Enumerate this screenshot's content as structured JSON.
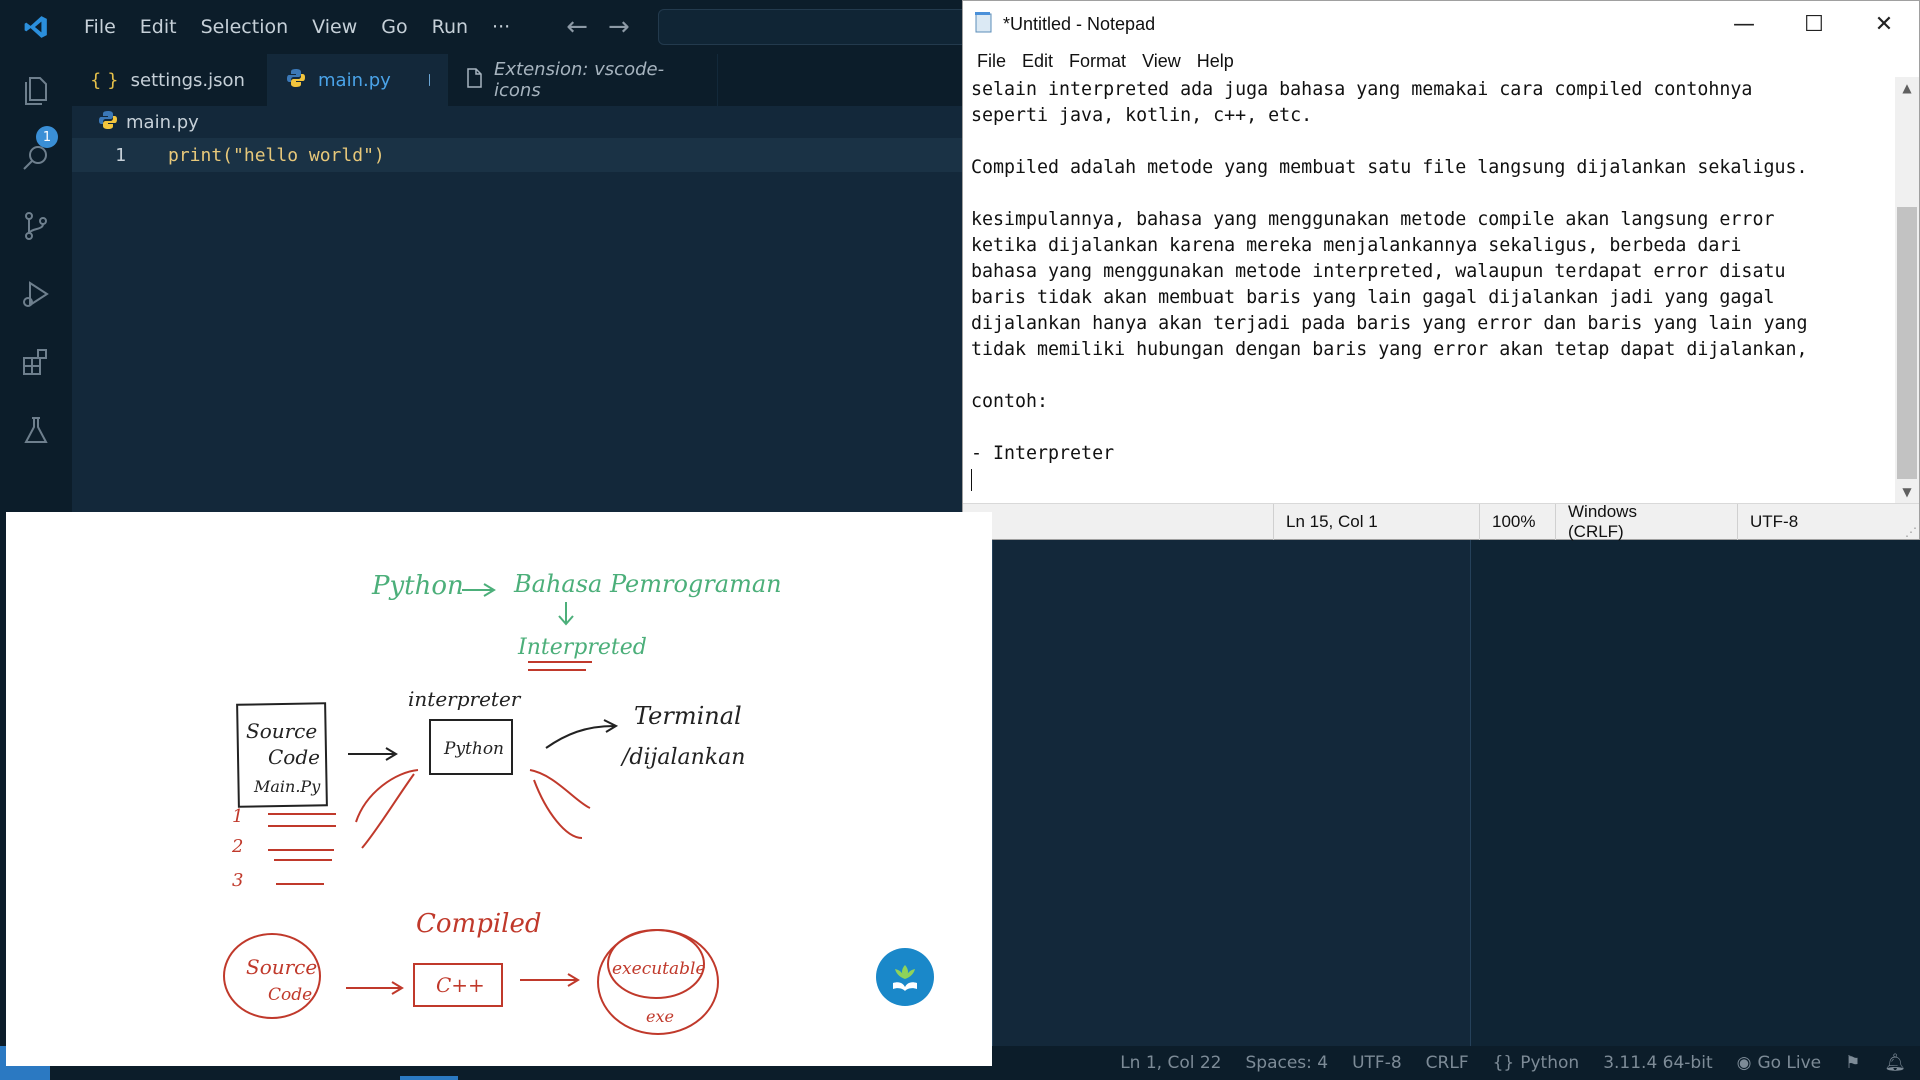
{
  "vscode": {
    "menu": [
      "File",
      "Edit",
      "Selection",
      "View",
      "Go",
      "Run",
      "···"
    ],
    "explorer_badge": "1",
    "tabs": [
      {
        "label": "settings.json",
        "icon": "json-braces-icon"
      },
      {
        "label": "main.py",
        "icon": "python-icon",
        "active": true,
        "modified": true
      },
      {
        "label": "Extension: vscode-icons",
        "icon": "file-icon"
      }
    ],
    "breadcrumb": "main.py",
    "code": {
      "line_number": "1",
      "text": "print(\"hello world\")"
    },
    "status": {
      "position": "Ln 1, Col 22",
      "spaces": "Spaces: 4",
      "encoding": "UTF-8",
      "eol": "CRLF",
      "language": "Python",
      "interpreter": "3.11.4 64-bit",
      "go_live": "Go Live"
    },
    "colors": {
      "accent": "#2b79c2",
      "background": "#13283a"
    }
  },
  "notepad": {
    "title": "*Untitled - Notepad",
    "menu": [
      "File",
      "Edit",
      "Format",
      "View",
      "Help"
    ],
    "lines": [
      "selain interpreted ada juga bahasa yang memakai cara compiled contohnya",
      "seperti java, kotlin, c++, etc.",
      "",
      "Compiled adalah metode yang membuat satu file langsung dijalankan sekaligus.",
      "",
      "kesimpulannya, bahasa yang menggunakan metode compile akan langsung error",
      "ketika dijalankan karena mereka menjalankannya sekaligus, berbeda dari",
      "bahasa yang menggunakan metode interpreted, walaupun terdapat error disatu",
      "baris tidak akan membuat baris yang lain gagal dijalankan jadi yang gagal",
      "dijalankan hanya akan terjadi pada baris yang error dan baris yang lain yang",
      "tidak memiliki hubungan dengan baris yang error akan tetap dapat dijalankan,",
      "",
      "contoh:",
      "",
      "- Interpreter",
      ""
    ],
    "status": {
      "position": "Ln 15, Col 1",
      "zoom": "100%",
      "eol": "Windows (CRLF)",
      "encoding": "UTF-8"
    }
  },
  "whiteboard": {
    "green": {
      "title_left": "Python",
      "title_right": "Bahasa Pemrograman",
      "subtitle": "Interpreted"
    },
    "interpreter_label": "interpreter",
    "source_code_box": [
      "Source",
      "Code",
      "Main.Py"
    ],
    "python_box": "Python",
    "terminal_label": [
      "Terminal",
      "/dijalankan"
    ],
    "line_numbers": [
      "1",
      "2",
      "3"
    ],
    "compiled_label": "Compiled",
    "source_circle": [
      "Source",
      "Code"
    ],
    "cpp_box": "C++",
    "executable": [
      "executable",
      "exe"
    ],
    "colors": {
      "green": "#4caf7a",
      "red": "#c0392b",
      "ink": "#222222"
    }
  }
}
